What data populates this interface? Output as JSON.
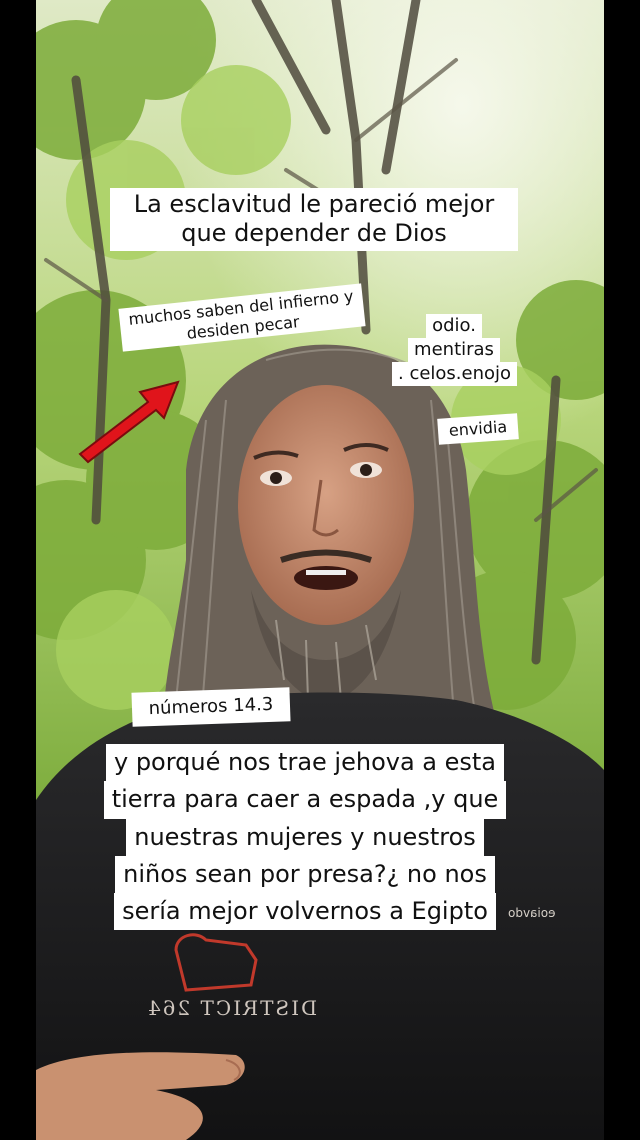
{
  "captions": {
    "title_line1": "La esclavitud le pareció mejor",
    "title_line2": "que depender de Dios",
    "muchos_line1": "muchos saben del infierno y",
    "muchos_line2": "desiden pecar",
    "odio_line1": "odio.",
    "odio_line2": "mentiras",
    "odio_line3": ". celos.enojo",
    "envidia": "envidia",
    "numeros": "números 14.3",
    "verse_line1": "y porqué nos trae jehova a esta",
    "verse_line2": "tierra para caer a espada ,y que",
    "verse_line3": "nuestras mujeres y nuestros",
    "verse_line4": "niños sean por presa?¿ no nos",
    "verse_line5": "sería mejor volvernos a Egipto"
  },
  "shirt": {
    "print_text": "DISTRICT 264",
    "logo_text": "eoiavdo"
  },
  "colors": {
    "caption_bg": "#ffffff",
    "caption_text": "#111111",
    "arrow_red": "#e0141b",
    "foliage": "#8fbf4a",
    "shirt": "#1c1c1e"
  }
}
